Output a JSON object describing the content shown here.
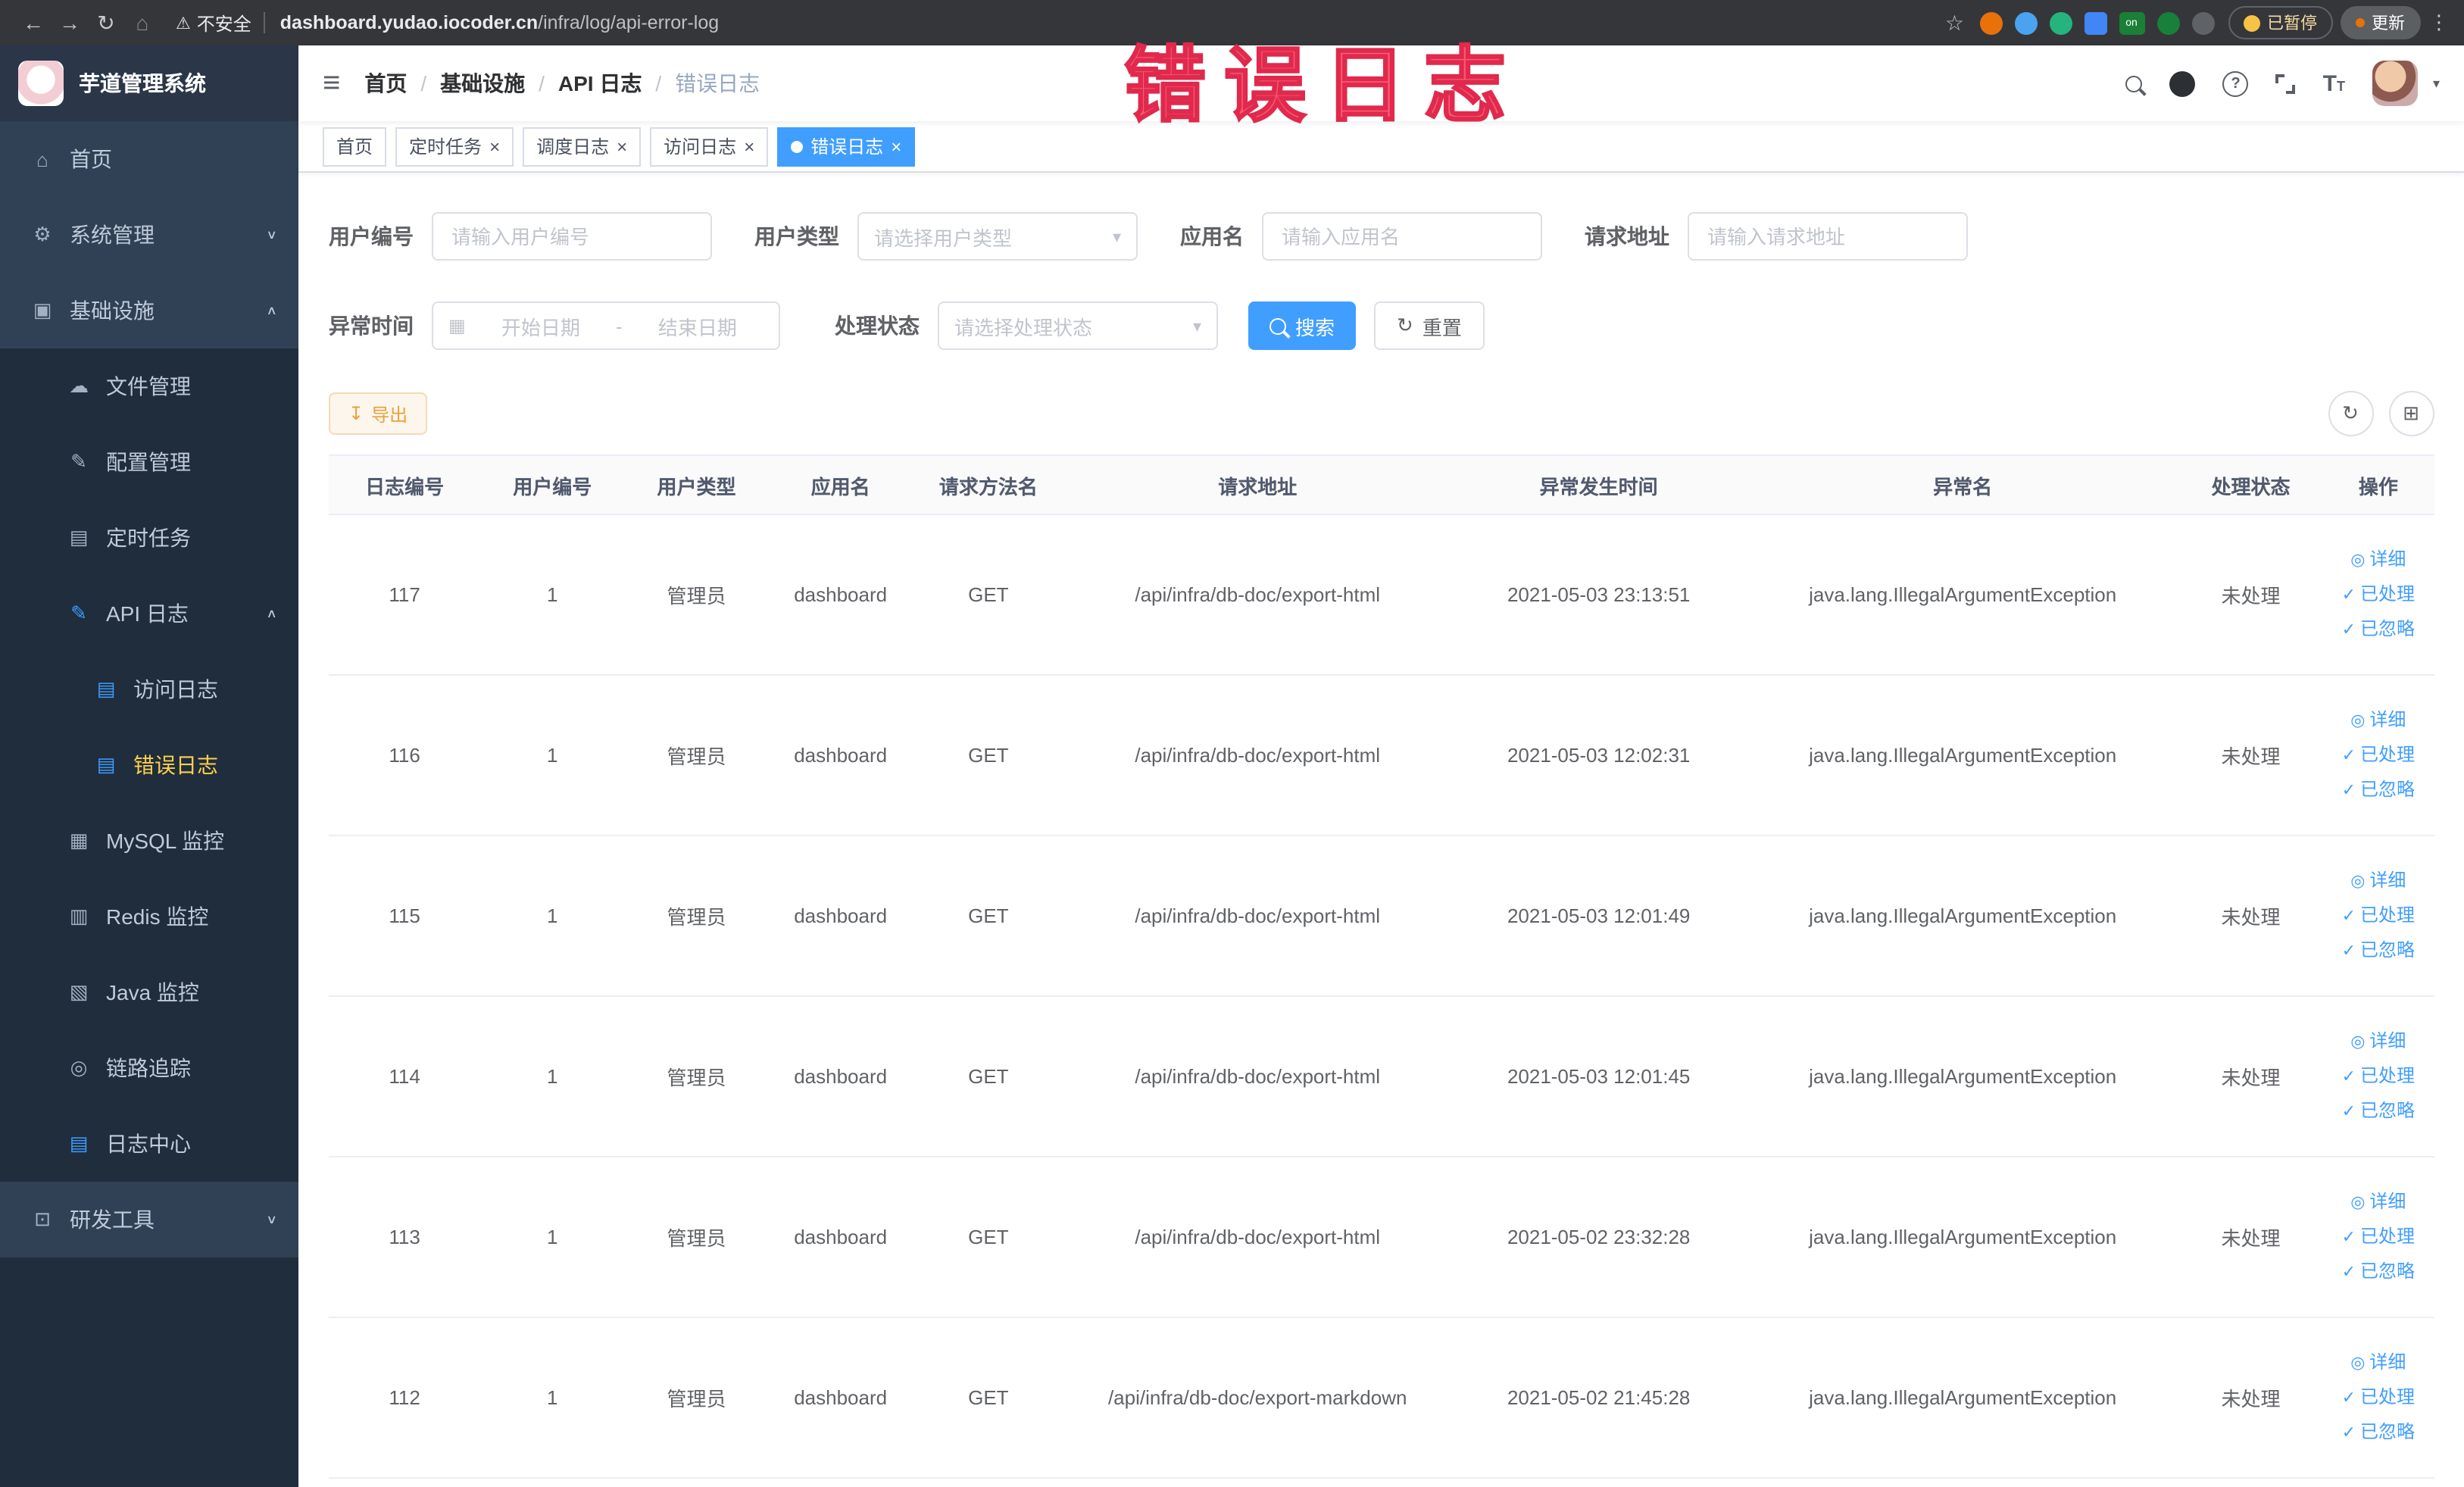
{
  "browser": {
    "security_label": "不安全",
    "url_domain": "dashboard.yudao.iocoder.cn",
    "url_path": "/infra/log/api-error-log",
    "paused_label": "已暂停",
    "update_label": "更新"
  },
  "overlay": {
    "text": "错误日志"
  },
  "sidebar": {
    "logo_title": "芋道管理系统",
    "items": [
      {
        "key": "home",
        "label": "首页",
        "level": 1,
        "icon": "home-icon"
      },
      {
        "key": "system",
        "label": "系统管理",
        "level": 1,
        "icon": "gear-icon",
        "chevron": "down"
      },
      {
        "key": "infra",
        "label": "基础设施",
        "level": 1,
        "icon": "infra-icon",
        "chevron": "up"
      },
      {
        "key": "file",
        "label": "文件管理",
        "level": 2,
        "icon": "cloud-icon"
      },
      {
        "key": "config",
        "label": "配置管理",
        "level": 2,
        "icon": "config-icon"
      },
      {
        "key": "job",
        "label": "定时任务",
        "level": 2,
        "icon": "task-icon"
      },
      {
        "key": "api-log",
        "label": "API 日志",
        "level": 2,
        "icon": "api-log-icon",
        "icon_blue": true,
        "chevron": "up"
      },
      {
        "key": "access-log",
        "label": "访问日志",
        "level": 3,
        "icon": "doc-icon",
        "icon_blue": true
      },
      {
        "key": "error-log",
        "label": "错误日志",
        "level": 3,
        "icon": "doc-icon",
        "icon_blue": true,
        "active": true
      },
      {
        "key": "mysql",
        "label": "MySQL 监控",
        "level": 2,
        "icon": "mysql-icon"
      },
      {
        "key": "redis",
        "label": "Redis 监控",
        "level": 2,
        "icon": "redis-icon"
      },
      {
        "key": "java",
        "label": "Java 监控",
        "level": 2,
        "icon": "java-icon"
      },
      {
        "key": "trace",
        "label": "链路追踪",
        "level": 2,
        "icon": "trace-icon"
      },
      {
        "key": "log-center",
        "label": "日志中心",
        "level": 2,
        "icon": "log-center-icon",
        "icon_blue": true
      },
      {
        "key": "dev-tools",
        "label": "研发工具",
        "level": 1,
        "icon": "tools-icon",
        "chevron": "down"
      }
    ]
  },
  "header": {
    "breadcrumb": [
      "首页",
      "基础设施",
      "API 日志",
      "错误日志"
    ]
  },
  "tabs": [
    {
      "key": "home",
      "label": "首页",
      "closable": false,
      "active": false
    },
    {
      "key": "job",
      "label": "定时任务",
      "closable": true,
      "active": false
    },
    {
      "key": "job-log",
      "label": "调度日志",
      "closable": true,
      "active": false
    },
    {
      "key": "access-log",
      "label": "访问日志",
      "closable": true,
      "active": false
    },
    {
      "key": "error-log",
      "label": "错误日志",
      "closable": true,
      "active": true
    }
  ],
  "filters": {
    "user_id": {
      "label": "用户编号",
      "placeholder": "请输入用户编号"
    },
    "user_type": {
      "label": "用户类型",
      "placeholder": "请选择用户类型"
    },
    "app_name": {
      "label": "应用名",
      "placeholder": "请输入应用名"
    },
    "request_url": {
      "label": "请求地址",
      "placeholder": "请输入请求地址"
    },
    "exception_time": {
      "label": "异常时间",
      "start_placeholder": "开始日期",
      "separator": "-",
      "end_placeholder": "结束日期"
    },
    "process_status": {
      "label": "处理状态",
      "placeholder": "请选择处理状态"
    },
    "search_label": "搜索",
    "reset_label": "重置"
  },
  "toolbar": {
    "export_label": "导出"
  },
  "table": {
    "columns": [
      "日志编号",
      "用户编号",
      "用户类型",
      "应用名",
      "请求方法名",
      "请求地址",
      "异常发生时间",
      "异常名",
      "处理状态",
      "操作"
    ],
    "actions": {
      "detail": "详细",
      "processed": "已处理",
      "ignored": "已忽略"
    },
    "rows": [
      {
        "id": "117",
        "user_id": "1",
        "user_type": "管理员",
        "app": "dashboard",
        "method": "GET",
        "url": "/api/infra/db-doc/export-html",
        "time": "2021-05-03 23:13:51",
        "exception": "java.lang.IllegalArgumentException",
        "status": "未处理"
      },
      {
        "id": "116",
        "user_id": "1",
        "user_type": "管理员",
        "app": "dashboard",
        "method": "GET",
        "url": "/api/infra/db-doc/export-html",
        "time": "2021-05-03 12:02:31",
        "exception": "java.lang.IllegalArgumentException",
        "status": "未处理"
      },
      {
        "id": "115",
        "user_id": "1",
        "user_type": "管理员",
        "app": "dashboard",
        "method": "GET",
        "url": "/api/infra/db-doc/export-html",
        "time": "2021-05-03 12:01:49",
        "exception": "java.lang.IllegalArgumentException",
        "status": "未处理"
      },
      {
        "id": "114",
        "user_id": "1",
        "user_type": "管理员",
        "app": "dashboard",
        "method": "GET",
        "url": "/api/infra/db-doc/export-html",
        "time": "2021-05-03 12:01:45",
        "exception": "java.lang.IllegalArgumentException",
        "status": "未处理"
      },
      {
        "id": "113",
        "user_id": "1",
        "user_type": "管理员",
        "app": "dashboard",
        "method": "GET",
        "url": "/api/infra/db-doc/export-html",
        "time": "2021-05-02 23:32:28",
        "exception": "java.lang.IllegalArgumentException",
        "status": "未处理"
      },
      {
        "id": "112",
        "user_id": "1",
        "user_type": "管理员",
        "app": "dashboard",
        "method": "GET",
        "url": "/api/infra/db-doc/export-markdown",
        "time": "2021-05-02 21:45:28",
        "exception": "java.lang.IllegalArgumentException",
        "status": "未处理"
      }
    ]
  }
}
